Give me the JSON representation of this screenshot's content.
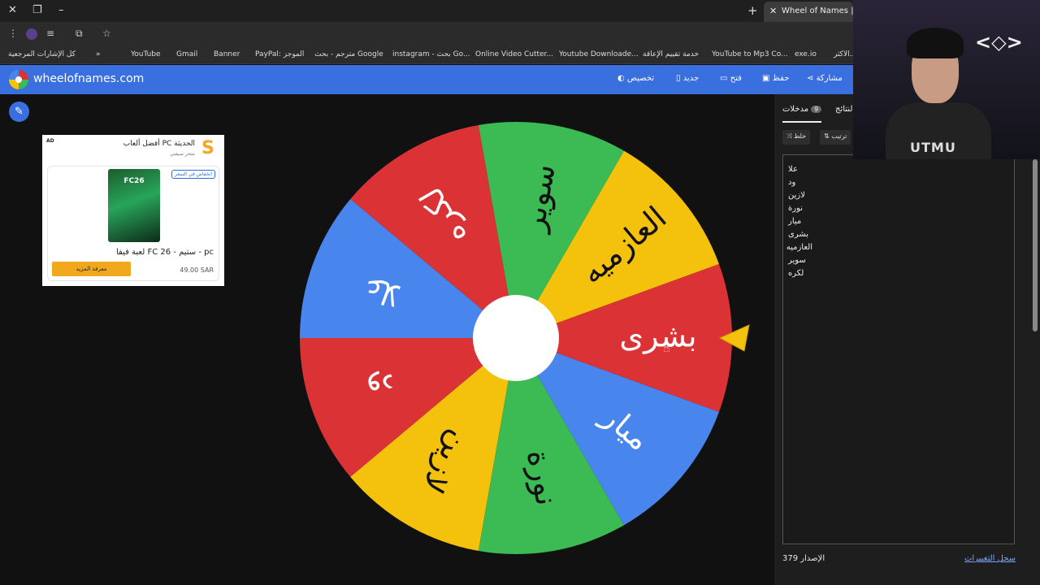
{
  "browser": {
    "tab_title": "Wheel of Names | شوالي",
    "bookmarks": [
      "الاكثر...",
      "exe.io",
      "YouTube to Mp3 Co...",
      "خدمة تقييم الإعاقة",
      "Youtube Downloade...",
      "Online Video Cutter...",
      "instagram - بحث Go...",
      "مترجم - بحث Google",
      "PayPal: الموجز",
      "Banner",
      "Gmail",
      "YouTube",
      "»",
      "كل الإشارات المرجعية"
    ]
  },
  "app": {
    "site_name": "wheelofnames.com",
    "menu": {
      "customize": "تخصيص",
      "new": "جديد",
      "open": "فتح",
      "save": "حفظ",
      "share": "مشاركة"
    }
  },
  "ad": {
    "ad_tag": "AD",
    "headline": "أفضل ألعاب PC الحديثة",
    "sub": "متجر سيفني",
    "badge": "انخفاض في السعر",
    "game_label": "FC26",
    "product_title": "لعبة فيفا FC 26 - ستيم - pc",
    "price": "49.00 SAR",
    "cta": "معرفة المزيد"
  },
  "wheel": {
    "segments": [
      {
        "label": "العازميه",
        "color": "#f4c20d"
      },
      {
        "label": "سوير",
        "color": "#3cba54"
      },
      {
        "label": "لكره",
        "color": "#db3236"
      },
      {
        "label": "علا",
        "color": "#4885ed"
      },
      {
        "label": "ود",
        "color": "#db3236"
      },
      {
        "label": "لازين",
        "color": "#f4c20d"
      },
      {
        "label": "نورة",
        "color": "#3cba54"
      },
      {
        "label": "ميار",
        "color": "#4885ed"
      },
      {
        "label": "بشرى",
        "color": "#db3236"
      }
    ]
  },
  "sidebar": {
    "tab_entries": "مدخلات",
    "tab_entries_count": "9",
    "tab_results": "النتائج",
    "shuffle": "خلط",
    "sort": "ترتيب",
    "entries": [
      "علا",
      "ود",
      "لازين",
      "نورة",
      "ميار",
      "بشرى",
      "العازميه",
      "سوير",
      "لكره"
    ],
    "version_label": "الإصدار",
    "version_number": "379",
    "changelog": "سجل التغييرات"
  },
  "webcam": {
    "shirt_text": "UTMU"
  }
}
